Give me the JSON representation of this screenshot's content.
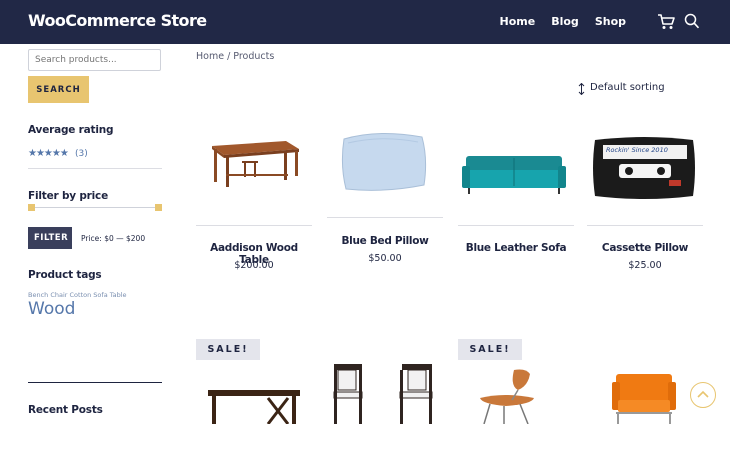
{
  "header": {
    "brand": "WooCommerce Store",
    "nav": [
      "Home",
      "Blog",
      "Shop"
    ],
    "icons": [
      "cart-icon",
      "search-icon"
    ]
  },
  "sidebar": {
    "search_placeholder": "Search products...",
    "search_button": "SEARCH",
    "avg_rating_title": "Average rating",
    "rating_stars": "★★★★★",
    "rating_count": "(3)",
    "filter_price_title": "Filter by price",
    "filter_button": "FILTER",
    "price_range": "Price: $0 — $200",
    "tags_title": "Product tags",
    "tags_small": "Bench Chair Cotton Sofa Table",
    "tag_large": "Wood",
    "recent_posts_title": "Recent Posts"
  },
  "main": {
    "breadcrumb": "Home / Products",
    "sorting": "Default sorting",
    "products": [
      {
        "name": "Aaddison Wood Table",
        "price": "$200.00"
      },
      {
        "name": "Blue Bed Pillow",
        "price": "$50.00"
      },
      {
        "name": "Blue Leather Sofa",
        "price": ""
      },
      {
        "name": "Cassette Pillow",
        "price": "$25.00"
      }
    ],
    "pillow_print": "Rockin' Since 2010",
    "sale_badge": "SALE!"
  },
  "colors": {
    "header_bg": "#212846",
    "accent": "#e8c570",
    "text_dark": "#1e2440",
    "link_blue": "#5577aa"
  }
}
